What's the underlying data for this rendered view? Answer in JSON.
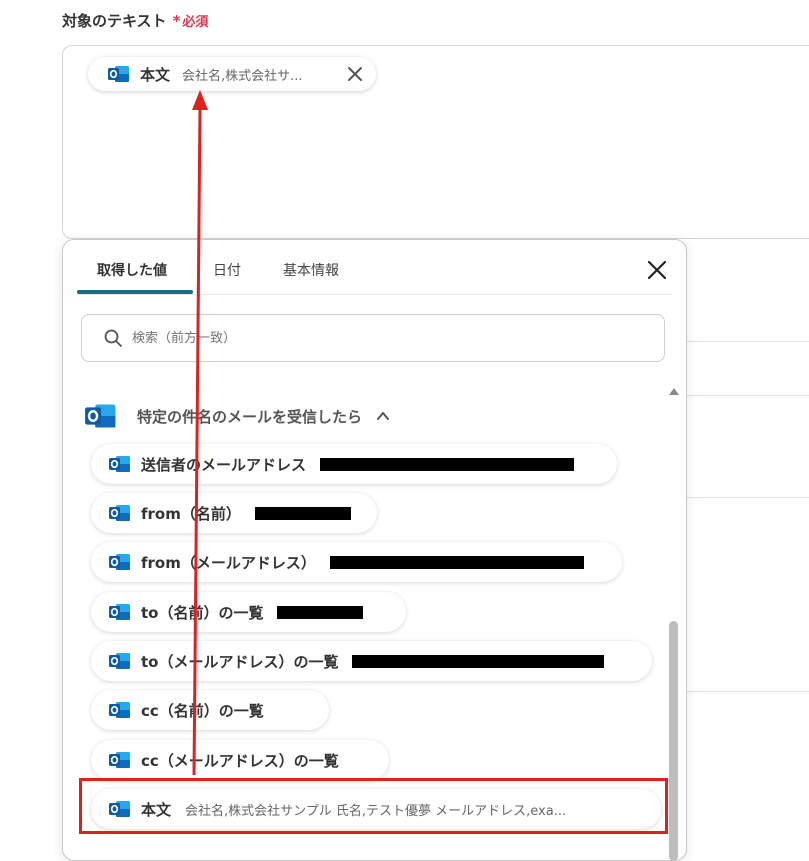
{
  "field": {
    "label": "対象のテキスト",
    "required_star": "*",
    "required_text": "必須",
    "chip": {
      "icon": "outlook-icon",
      "label": "本文",
      "value": "会社名,株式会社サ..."
    }
  },
  "popup": {
    "tabs": [
      {
        "label": "取得した値",
        "active": true
      },
      {
        "label": "日付",
        "active": false
      },
      {
        "label": "基本情報",
        "active": false
      }
    ],
    "search": {
      "placeholder": "検索（前方一致）"
    },
    "group": {
      "icon": "outlook-icon",
      "title": "特定の件名のメールを受信したら"
    },
    "items": [
      {
        "label": "送信者のメールアドレス",
        "value": ""
      },
      {
        "label": "from（名前）",
        "value": ""
      },
      {
        "label": "from（メールアドレス）",
        "value": ""
      },
      {
        "label": "to（名前）の一覧",
        "value": ""
      },
      {
        "label": "to（メールアドレス）の一覧",
        "value": ""
      },
      {
        "label": "cc（名前）の一覧",
        "value": ""
      },
      {
        "label": "cc（メールアドレス）の一覧",
        "value": ""
      },
      {
        "label": "本文",
        "value": "会社名,株式会社サンプル 氏名,テスト優夢 メールアドレス,exa..."
      }
    ]
  },
  "colors": {
    "accent": "#1b6d82",
    "required": "#e0364e",
    "annotation": "#e02020",
    "outlook_blue": "#0f6cbd"
  }
}
